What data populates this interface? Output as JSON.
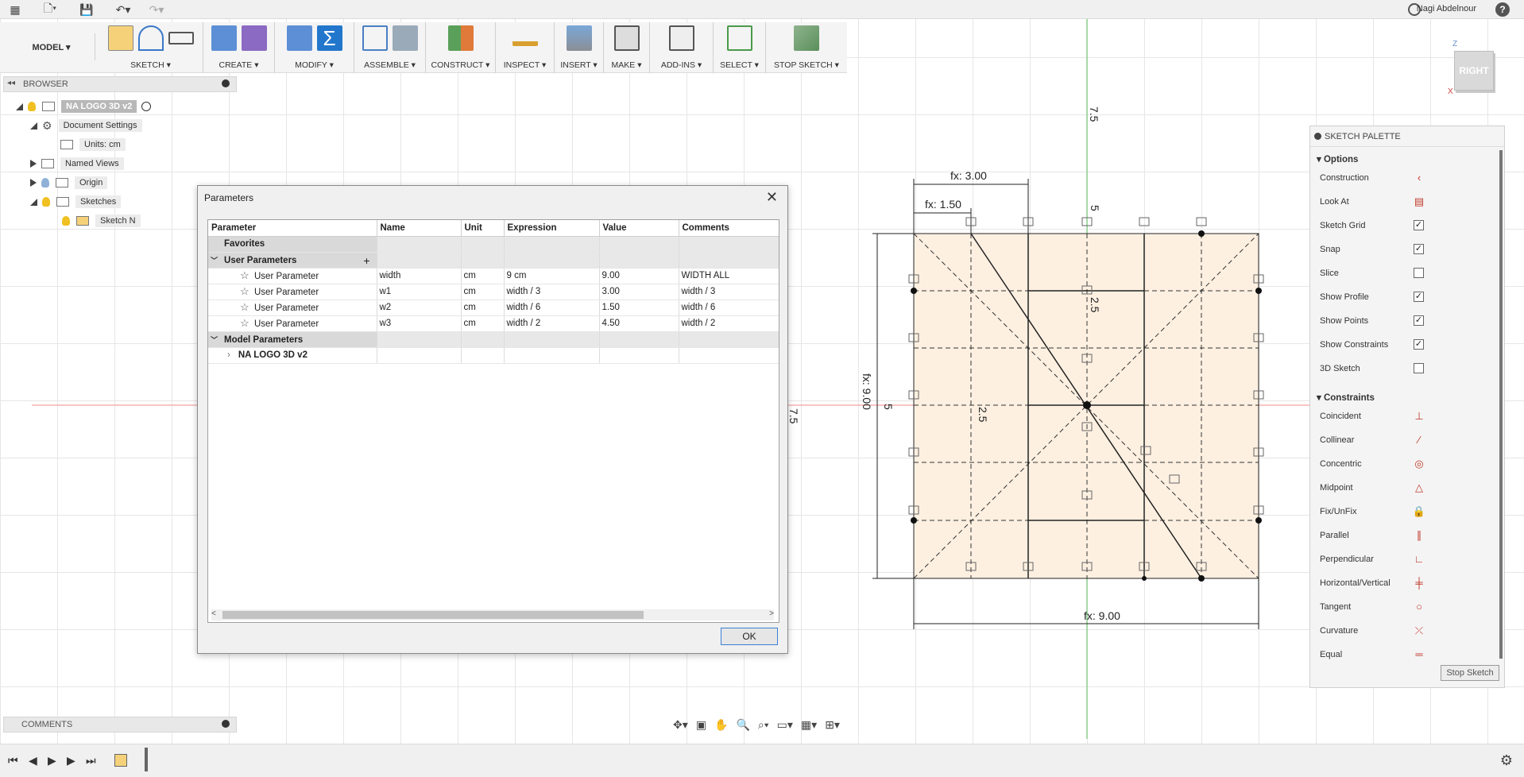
{
  "user": {
    "name": "Nagi Abdelnour"
  },
  "icons": {
    "apps": "grid-icon",
    "file": "file-icon",
    "save": "save-icon",
    "undo": "undo-icon",
    "redo": "redo-icon",
    "clock": "clock-icon",
    "help": "help-icon"
  },
  "ribbon": {
    "workspace": "MODEL ▾",
    "groups": [
      {
        "label": "SKETCH ▾"
      },
      {
        "label": "CREATE ▾"
      },
      {
        "label": "MODIFY ▾"
      },
      {
        "label": "ASSEMBLE ▾"
      },
      {
        "label": "CONSTRUCT ▾"
      },
      {
        "label": "INSPECT ▾"
      },
      {
        "label": "INSERT ▾"
      },
      {
        "label": "MAKE ▾"
      },
      {
        "label": "ADD-INS ▾"
      },
      {
        "label": "SELECT ▾"
      },
      {
        "label": "STOP SKETCH ▾"
      }
    ]
  },
  "browser": {
    "title": "BROWSER",
    "nodes": [
      {
        "label": "NA LOGO 3D v2"
      },
      {
        "label": "Document Settings"
      },
      {
        "label": "Units: cm"
      },
      {
        "label": "Named Views"
      },
      {
        "label": "Origin"
      },
      {
        "label": "Sketches"
      },
      {
        "label": "Sketch N"
      }
    ]
  },
  "dialog": {
    "title": "Parameters",
    "columns": [
      "Parameter",
      "Name",
      "Unit",
      "Expression",
      "Value",
      "Comments"
    ],
    "favorites_label": "Favorites",
    "user_params_label": "User Parameters",
    "model_params_label": "Model Parameters",
    "model_item": "NA LOGO 3D v2",
    "rows": [
      {
        "param": "User Parameter",
        "name": "width",
        "unit": "cm",
        "expr": "9 cm",
        "value": "9.00",
        "comment": "WIDTH ALL"
      },
      {
        "param": "User Parameter",
        "name": "w1",
        "unit": "cm",
        "expr": "width / 3",
        "value": "3.00",
        "comment": "width / 3"
      },
      {
        "param": "User Parameter",
        "name": "w2",
        "unit": "cm",
        "expr": "width / 6",
        "value": "1.50",
        "comment": "width / 6"
      },
      {
        "param": "User Parameter",
        "name": "w3",
        "unit": "cm",
        "expr": "width / 2",
        "value": "4.50",
        "comment": "width / 2"
      }
    ],
    "ok_label": "OK"
  },
  "viewcube": {
    "face": "RIGHT",
    "z": "Z",
    "x": "X"
  },
  "sketch": {
    "dim_top1": "fx: 3.00",
    "dim_top2": "fx: 1.50",
    "dim_left": "fx: 9.00",
    "dim_bottom": "fx: 9.00",
    "axis_label_a": "7.5",
    "axis_label_b": "7.5",
    "axis_label_c": "5",
    "axis_label_d": "2.5",
    "axis_label_e": "5",
    "axis_label_f": "2.5"
  },
  "palette": {
    "title": "SKETCH PALETTE",
    "options_label": "Options",
    "options": [
      {
        "label": "Construction",
        "kind": "icon",
        "icon": "‹"
      },
      {
        "label": "Look At",
        "kind": "icon",
        "icon": "▤"
      },
      {
        "label": "Sketch Grid",
        "kind": "check",
        "checked": "✓"
      },
      {
        "label": "Snap",
        "kind": "check",
        "checked": "✓"
      },
      {
        "label": "Slice",
        "kind": "check",
        "checked": ""
      },
      {
        "label": "Show Profile",
        "kind": "check",
        "checked": "✓"
      },
      {
        "label": "Show Points",
        "kind": "check",
        "checked": "✓"
      },
      {
        "label": "Show Constraints",
        "kind": "check",
        "checked": "✓"
      },
      {
        "label": "3D Sketch",
        "kind": "check",
        "checked": ""
      }
    ],
    "constraints_label": "Constraints",
    "constraints": [
      {
        "label": "Coincident",
        "icon": "⊥"
      },
      {
        "label": "Collinear",
        "icon": "⁄"
      },
      {
        "label": "Concentric",
        "icon": "◎"
      },
      {
        "label": "Midpoint",
        "icon": "△"
      },
      {
        "label": "Fix/UnFix",
        "icon": "🔒"
      },
      {
        "label": "Parallel",
        "icon": "∥"
      },
      {
        "label": "Perpendicular",
        "icon": "∟"
      },
      {
        "label": "Horizontal/Vertical",
        "icon": "╪"
      },
      {
        "label": "Tangent",
        "icon": "○"
      },
      {
        "label": "Curvature",
        "icon": "⤫"
      },
      {
        "label": "Equal",
        "icon": "═"
      }
    ],
    "stop_label": "Stop Sketch"
  },
  "comments": {
    "title": "COMMENTS"
  }
}
